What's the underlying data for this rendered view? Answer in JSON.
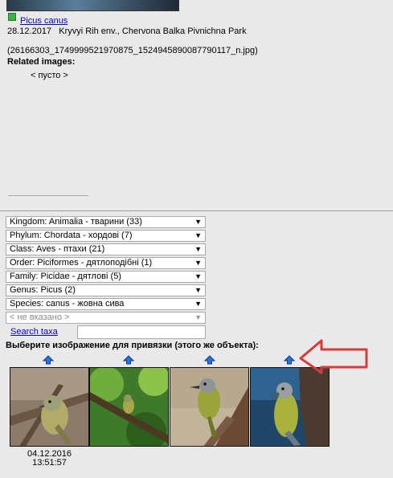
{
  "record": {
    "species_link": "Picus canus",
    "date": "28.12.2017",
    "location": "Kryvyi Rih env., Chervona Balka Pivnichna Park",
    "filename": "(26166303_1749999521970875_1524945890087790117_n.jpg)"
  },
  "related": {
    "label": "Related images:",
    "empty": "< пусто >"
  },
  "taxonomy": [
    {
      "label": "Kingdom: Animalia - тварини (33)"
    },
    {
      "label": "Phylum: Chordata - хордові (7)"
    },
    {
      "label": "Class: Aves - птахи (21)"
    },
    {
      "label": "Order: Piciformes - дятлоподібні (1)"
    },
    {
      "label": "Family: Picidae - дятлові (5)"
    },
    {
      "label": "Genus: Picus (2)"
    },
    {
      "label": "Species: canus - жовна сива"
    },
    {
      "label": "< не вказано >"
    }
  ],
  "search": {
    "link": "Search taxa",
    "value": ""
  },
  "choose_label": "Выберите изображение для привязки (этого же объекта):",
  "thumbnails": [
    {
      "date": "04.12.2016",
      "time": "13:51:57"
    }
  ],
  "colors": {
    "link": "#0000cc",
    "annotation_arrow": "#d93a3a",
    "up_icon": "#2f6fd6",
    "status_square": "#3cb043"
  }
}
